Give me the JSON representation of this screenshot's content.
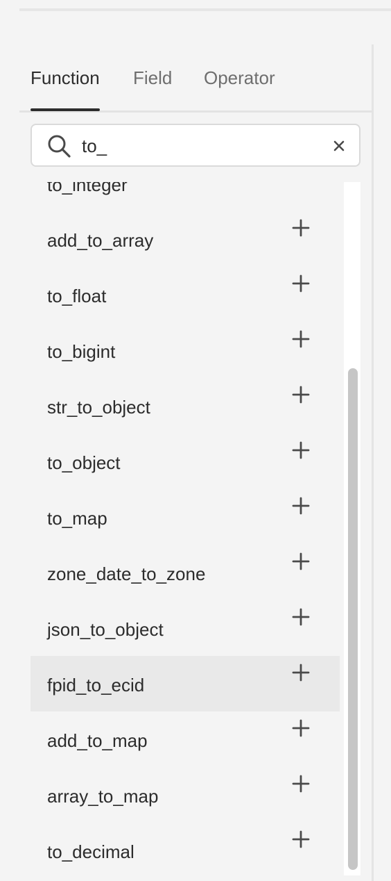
{
  "tabs": [
    {
      "label": "Function",
      "active": true
    },
    {
      "label": "Field",
      "active": false
    },
    {
      "label": "Operator",
      "active": false
    }
  ],
  "search": {
    "value": "to_",
    "icon": "search-icon",
    "clear_icon": "close-icon"
  },
  "functions": [
    {
      "label": "to_integer",
      "action_icon": "plus-icon"
    },
    {
      "label": "add_to_array",
      "action_icon": "plus-icon"
    },
    {
      "label": "to_float",
      "action_icon": "plus-icon"
    },
    {
      "label": "to_bigint",
      "action_icon": "plus-icon"
    },
    {
      "label": "str_to_object",
      "action_icon": "plus-icon"
    },
    {
      "label": "to_object",
      "action_icon": "plus-icon"
    },
    {
      "label": "to_map",
      "action_icon": "plus-icon"
    },
    {
      "label": "zone_date_to_zone",
      "action_icon": "plus-icon"
    },
    {
      "label": "json_to_object",
      "action_icon": "plus-icon"
    },
    {
      "label": "fpid_to_ecid",
      "action_icon": "plus-icon",
      "hovered": true
    },
    {
      "label": "add_to_map",
      "action_icon": "plus-icon"
    },
    {
      "label": "array_to_map",
      "action_icon": "plus-icon"
    },
    {
      "label": "to_decimal",
      "action_icon": "plus-icon"
    }
  ],
  "colors": {
    "background": "#f4f4f4",
    "text": "#2c2c2c",
    "muted_text": "#6e6e6e",
    "hover_row": "#e9e9e9",
    "scroll_thumb": "#c6c6c6"
  }
}
